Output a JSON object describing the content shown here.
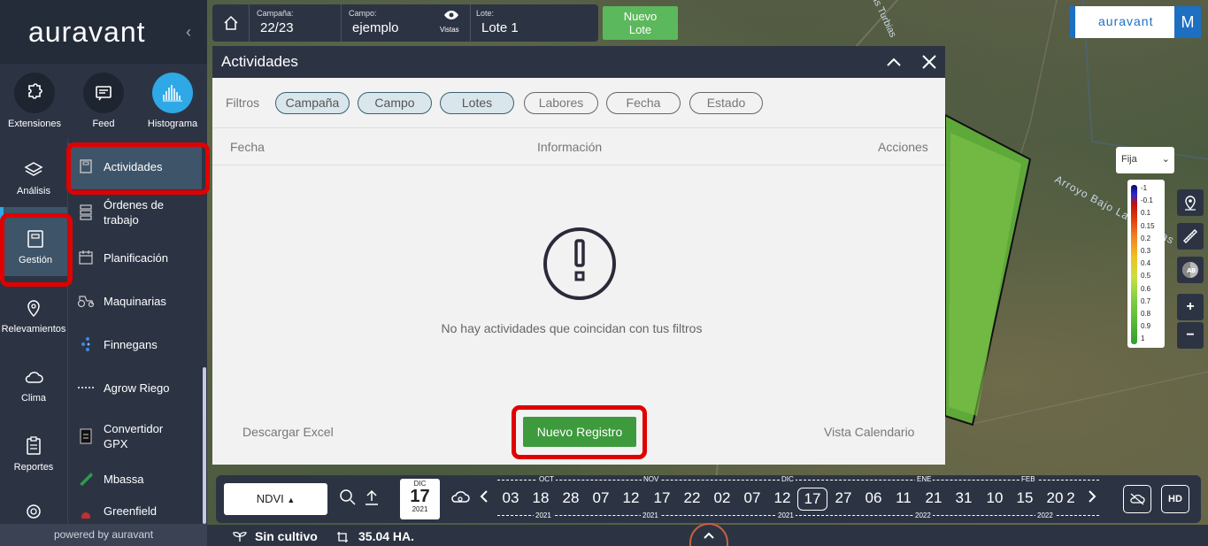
{
  "sidebar": {
    "logo": "auravant",
    "powered_by": "powered by auravant",
    "top_icons": [
      {
        "label": "Extensiones",
        "icon": "puzzle-icon"
      },
      {
        "label": "Feed",
        "icon": "feed-icon"
      },
      {
        "label": "Histograma",
        "icon": "histogram-icon",
        "active": true
      }
    ],
    "categories": [
      {
        "label": "Análisis",
        "icon": "layers-icon"
      },
      {
        "label": "Gestión",
        "icon": "notebook-icon",
        "active": true
      },
      {
        "label": "Relevamientos",
        "icon": "map-pin-icon"
      },
      {
        "label": "Clima",
        "icon": "cloud-icon"
      },
      {
        "label": "Reportes",
        "icon": "clipboard-icon"
      }
    ],
    "sub_items": [
      {
        "label": "Actividades",
        "active": true
      },
      {
        "label": "Órdenes de trabajo"
      },
      {
        "label": "Planificación"
      },
      {
        "label": "Maquinarias"
      },
      {
        "label": "Finnegans"
      },
      {
        "label": "Agrow Riego"
      },
      {
        "label": "Convertidor GPX"
      },
      {
        "label": "Mbassa"
      },
      {
        "label": "Greenfield"
      }
    ]
  },
  "topbar": {
    "campana_label": "Campaña:",
    "campana_value": "22/23",
    "campo_label": "Campo:",
    "campo_value": "ejemplo",
    "vistas_label": "Vistas",
    "lote_label": "Lote:",
    "lote_value": "Lote 1",
    "nuevo_lote_1": "Nuevo",
    "nuevo_lote_2": "Lote"
  },
  "brand": {
    "name": "auravant",
    "user_initial": "M"
  },
  "map": {
    "river_label": "Arroyo Bajo Las Turbias",
    "river_label_top": "Las Turbias",
    "mode_select": "Fija",
    "legend_values": [
      "-1",
      "-0.1",
      "0.1",
      "0.15",
      "0.2",
      "0.3",
      "0.4",
      "0.5",
      "0.6",
      "0.7",
      "0.8",
      "0.9",
      "1"
    ],
    "zoom_in": "+",
    "zoom_out": "−"
  },
  "modal": {
    "title": "Actividades",
    "filters_label": "Filtros",
    "filters": [
      {
        "label": "Campaña",
        "active": true
      },
      {
        "label": "Campo",
        "active": true
      },
      {
        "label": "Lotes",
        "active": true
      },
      {
        "label": "Labores",
        "active": false
      },
      {
        "label": "Fecha",
        "active": false
      },
      {
        "label": "Estado",
        "active": false
      }
    ],
    "columns": [
      "Fecha",
      "Información",
      "Acciones"
    ],
    "empty_message": "No hay actividades que coincidan con tus filtros",
    "download_excel": "Descargar Excel",
    "new_record": "Nuevo Registro",
    "calendar_view": "Vista Calendario"
  },
  "bottombar": {
    "index_select": "NDVI",
    "current_date": {
      "month": "DIC",
      "day": "17",
      "year": "2021"
    },
    "timeline_days": [
      "03",
      "18",
      "28",
      "07",
      "12",
      "17",
      "22",
      "02",
      "07",
      "12",
      "17",
      "27",
      "06",
      "11",
      "21",
      "31",
      "10",
      "15",
      "20",
      "2"
    ],
    "timeline_months": [
      "OCT",
      "NOV",
      "DIC",
      "ENE",
      "FEB"
    ],
    "timeline_years": [
      "2021",
      "2021",
      "2021",
      "2022",
      "2022"
    ],
    "hd_label": "HD"
  },
  "status": {
    "crop": "Sin cultivo",
    "area": "35.04 HA."
  }
}
